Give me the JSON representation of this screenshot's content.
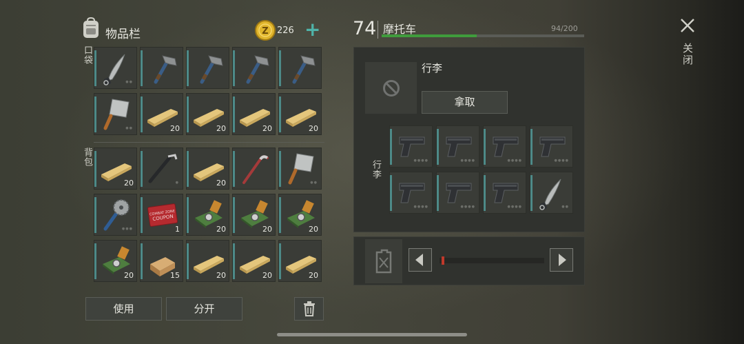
{
  "inventory": {
    "title": "物品栏",
    "coins": "226",
    "add_symbol": "+",
    "pocket_label": "口袋",
    "backpack_label": "背包",
    "pocket_slots": [
      {
        "item": "machete",
        "count": "",
        "dots": "●●"
      },
      {
        "item": "hatchet",
        "count": "",
        "dots": ""
      },
      {
        "item": "hatchet",
        "count": "",
        "dots": ""
      },
      {
        "item": "hatchet",
        "count": "",
        "dots": ""
      },
      {
        "item": "hatchet",
        "count": "",
        "dots": ""
      },
      {
        "item": "cleaver",
        "count": "",
        "dots": "●●"
      },
      {
        "item": "plank",
        "count": "20",
        "dots": ""
      },
      {
        "item": "plank",
        "count": "20",
        "dots": ""
      },
      {
        "item": "plank",
        "count": "20",
        "dots": ""
      },
      {
        "item": "plank",
        "count": "20",
        "dots": ""
      }
    ],
    "backpack_slots": [
      {
        "item": "plank",
        "count": "20",
        "dots": ""
      },
      {
        "item": "crowbar",
        "count": "",
        "dots": "●"
      },
      {
        "item": "plank",
        "count": "20",
        "dots": ""
      },
      {
        "item": "pry-bar",
        "count": "",
        "dots": ""
      },
      {
        "item": "cleaver",
        "count": "",
        "dots": "●●"
      },
      {
        "item": "saw-mace",
        "count": "",
        "dots": "●●●"
      },
      {
        "item": "coupon",
        "count": "1",
        "dots": "",
        "text1": "COMBAT ZONE",
        "text2": "COUPON"
      },
      {
        "item": "circuit-board",
        "count": "20",
        "dots": ""
      },
      {
        "item": "circuit-board",
        "count": "20",
        "dots": ""
      },
      {
        "item": "circuit-board",
        "count": "20",
        "dots": ""
      },
      {
        "item": "circuit-board",
        "count": "20",
        "dots": ""
      },
      {
        "item": "wood-log",
        "count": "15",
        "dots": ""
      },
      {
        "item": "plank",
        "count": "20",
        "dots": ""
      },
      {
        "item": "plank",
        "count": "20",
        "dots": ""
      },
      {
        "item": "plank",
        "count": "20",
        "dots": ""
      }
    ],
    "use_button": "使用",
    "split_button": "分开"
  },
  "vehicle": {
    "level": "74",
    "name": "摩托车",
    "capacity": "94/200",
    "capacity_fraction": 0.47,
    "accent_color": "#3f9c3c",
    "luggage_title": "行李",
    "take_button": "拿取",
    "luggage_label": "行李",
    "slots": [
      {
        "item": "pistol",
        "dots": "●●●●"
      },
      {
        "item": "pistol",
        "dots": "●●●●"
      },
      {
        "item": "pistol",
        "dots": "●●●●"
      },
      {
        "item": "pistol",
        "dots": "●●●●"
      },
      {
        "item": "pistol",
        "dots": "●●●●"
      },
      {
        "item": "pistol",
        "dots": "●●●●"
      },
      {
        "item": "pistol",
        "dots": "●●●●"
      },
      {
        "item": "machete",
        "dots": "●●"
      }
    ],
    "fuel_level_fraction": 0.02
  },
  "close": {
    "label": "关闭"
  },
  "colors": {
    "slot_accent": "#4d8a88",
    "fuel_marker": "#c0392b",
    "coin": "#e0b52c",
    "plus": "#4fb3a9"
  }
}
